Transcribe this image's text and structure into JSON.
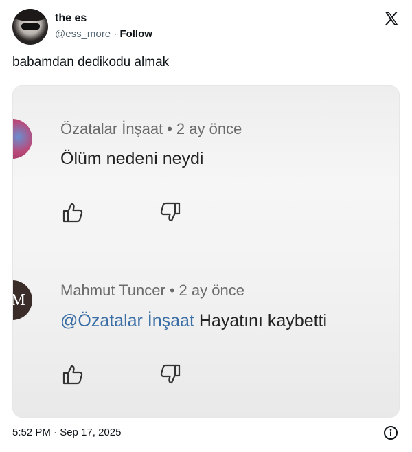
{
  "author": {
    "name": "the es",
    "handle": "@ess_more",
    "separator": " · ",
    "follow_label": "Follow"
  },
  "tweet": {
    "text": "babamdan dedikodu almak",
    "timestamp": "5:52 PM · Sep 17, 2025"
  },
  "icons": {
    "brand": "x-logo-icon",
    "info": "info-icon"
  },
  "media": {
    "comments": [
      {
        "author": "Özatalar İnşaat",
        "age": "2 ay önce",
        "text": "Ölüm nedeni neydi",
        "avatar_color": "#b94a7a"
      },
      {
        "author": "Mahmut Tuncer",
        "age": "2 ay önce",
        "mention": "@Özatalar İnşaat",
        "text": "Hayatını kaybetti",
        "avatar_letter": "M",
        "avatar_color": "#3a2c28"
      }
    ],
    "mention_color": "#3a6ea5"
  }
}
